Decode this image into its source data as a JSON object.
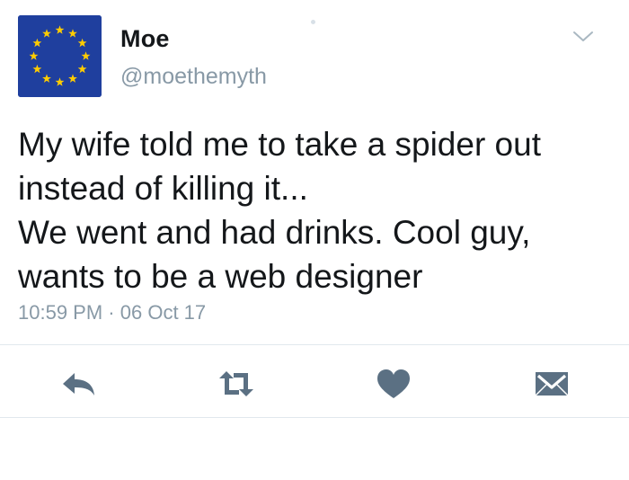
{
  "user": {
    "name": "Moe",
    "handle": "@moethemyth",
    "avatar_icon": "eu-flag-icon"
  },
  "tweet": {
    "lines": [
      "My wife told me to take a spider out",
      "instead of killing it...",
      "We went and had drinks. Cool guy,",
      "wants to be a web designer"
    ],
    "time": "10:59 PM",
    "separator": "·",
    "date": "06 Oct 17"
  },
  "actions": {
    "reply_icon": "reply-icon",
    "retweet_icon": "retweet-icon",
    "like_icon": "heart-icon",
    "dm_icon": "envelope-icon",
    "menu_icon": "chevron-down-icon"
  },
  "colors": {
    "text": "#14171a",
    "secondary": "#8899a6",
    "icon": "#5b7083",
    "avatar_blue": "#1f3f9e",
    "star_yellow": "#ffcc00",
    "divider": "#e1e8ed"
  }
}
